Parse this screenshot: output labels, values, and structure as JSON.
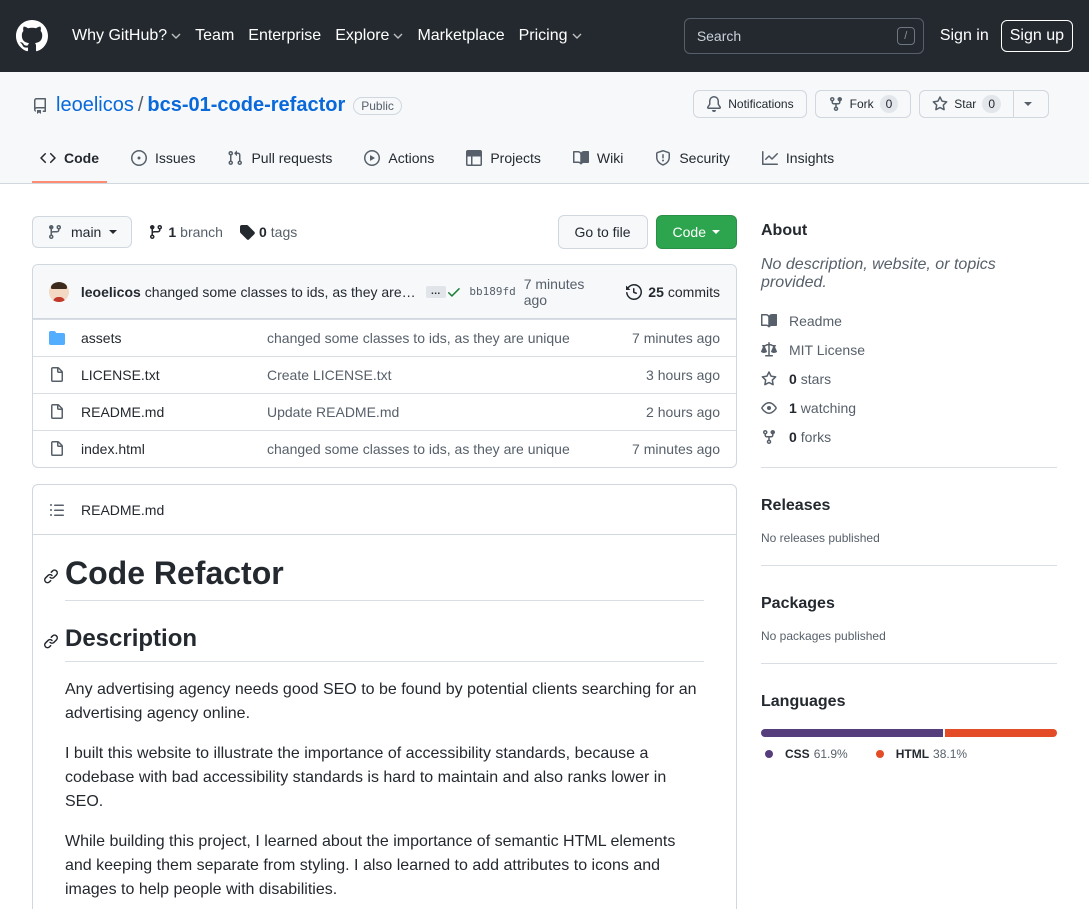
{
  "header": {
    "nav": [
      {
        "label": "Why GitHub?",
        "dropdown": true
      },
      {
        "label": "Team",
        "dropdown": false
      },
      {
        "label": "Enterprise",
        "dropdown": false
      },
      {
        "label": "Explore",
        "dropdown": true
      },
      {
        "label": "Marketplace",
        "dropdown": false
      },
      {
        "label": "Pricing",
        "dropdown": true
      }
    ],
    "search_placeholder": "Search",
    "search_shortcut": "/",
    "sign_in": "Sign in",
    "sign_up": "Sign up"
  },
  "repo": {
    "owner": "leoelicos",
    "separator": "/",
    "name": "bcs-01-code-refactor",
    "visibility": "Public",
    "notifications_label": "Notifications",
    "fork_label": "Fork",
    "fork_count": "0",
    "star_label": "Star",
    "star_count": "0",
    "tabs": [
      {
        "label": "Code",
        "icon": "code-icon",
        "active": true
      },
      {
        "label": "Issues",
        "icon": "issue-icon",
        "active": false
      },
      {
        "label": "Pull requests",
        "icon": "pull-request-icon",
        "active": false
      },
      {
        "label": "Actions",
        "icon": "play-icon",
        "active": false
      },
      {
        "label": "Projects",
        "icon": "table-icon",
        "active": false
      },
      {
        "label": "Wiki",
        "icon": "book-icon",
        "active": false
      },
      {
        "label": "Security",
        "icon": "shield-icon",
        "active": false
      },
      {
        "label": "Insights",
        "icon": "graph-icon",
        "active": false
      }
    ]
  },
  "toolbar": {
    "branch": "main",
    "branch_count": "1",
    "branch_label": "branch",
    "tag_count": "0",
    "tag_label": "tags",
    "go_to_file": "Go to file",
    "code_button": "Code"
  },
  "commit": {
    "author": "leoelicos",
    "message": "changed some classes to ids, as they are…",
    "ellipsis": "…",
    "sha": "bb189fd",
    "time": "7 minutes ago",
    "commit_count": "25",
    "commit_label": "commits"
  },
  "files": [
    {
      "name": "assets",
      "type": "folder",
      "commit": "changed some classes to ids, as they are unique",
      "time": "7 minutes ago"
    },
    {
      "name": "LICENSE.txt",
      "type": "file",
      "commit": "Create LICENSE.txt",
      "time": "3 hours ago"
    },
    {
      "name": "README.md",
      "type": "file",
      "commit": "Update README.md",
      "time": "2 hours ago"
    },
    {
      "name": "index.html",
      "type": "file",
      "commit": "changed some classes to ids, as they are unique",
      "time": "7 minutes ago"
    }
  ],
  "readme": {
    "filename": "README.md",
    "h1": "Code Refactor",
    "h2": "Description",
    "paragraphs": [
      "Any advertising agency needs good SEO to be found by potential clients searching for an advertising agency online.",
      "I built this website to illustrate the importance of accessibility standards, because a codebase with bad accessibility standards is hard to maintain and also ranks lower in SEO.",
      "While building this project, I learned about the importance of semantic HTML elements and keeping them separate from styling. I also learned to add attributes to icons and images to help people with disabilities."
    ]
  },
  "about": {
    "title": "About",
    "description": "No description, website, or topics provided.",
    "readme": "Readme",
    "license": "MIT License",
    "stars_count": "0",
    "stars_label": "stars",
    "watching_count": "1",
    "watching_label": "watching",
    "forks_count": "0",
    "forks_label": "forks"
  },
  "releases": {
    "title": "Releases",
    "note": "No releases published"
  },
  "packages": {
    "title": "Packages",
    "note": "No packages published"
  },
  "languages": {
    "title": "Languages",
    "items": [
      {
        "name": "CSS",
        "percent": "61.9%",
        "value": 61.9,
        "color": "#563d7c"
      },
      {
        "name": "HTML",
        "percent": "38.1%",
        "value": 38.1,
        "color": "#e34c26"
      }
    ]
  }
}
